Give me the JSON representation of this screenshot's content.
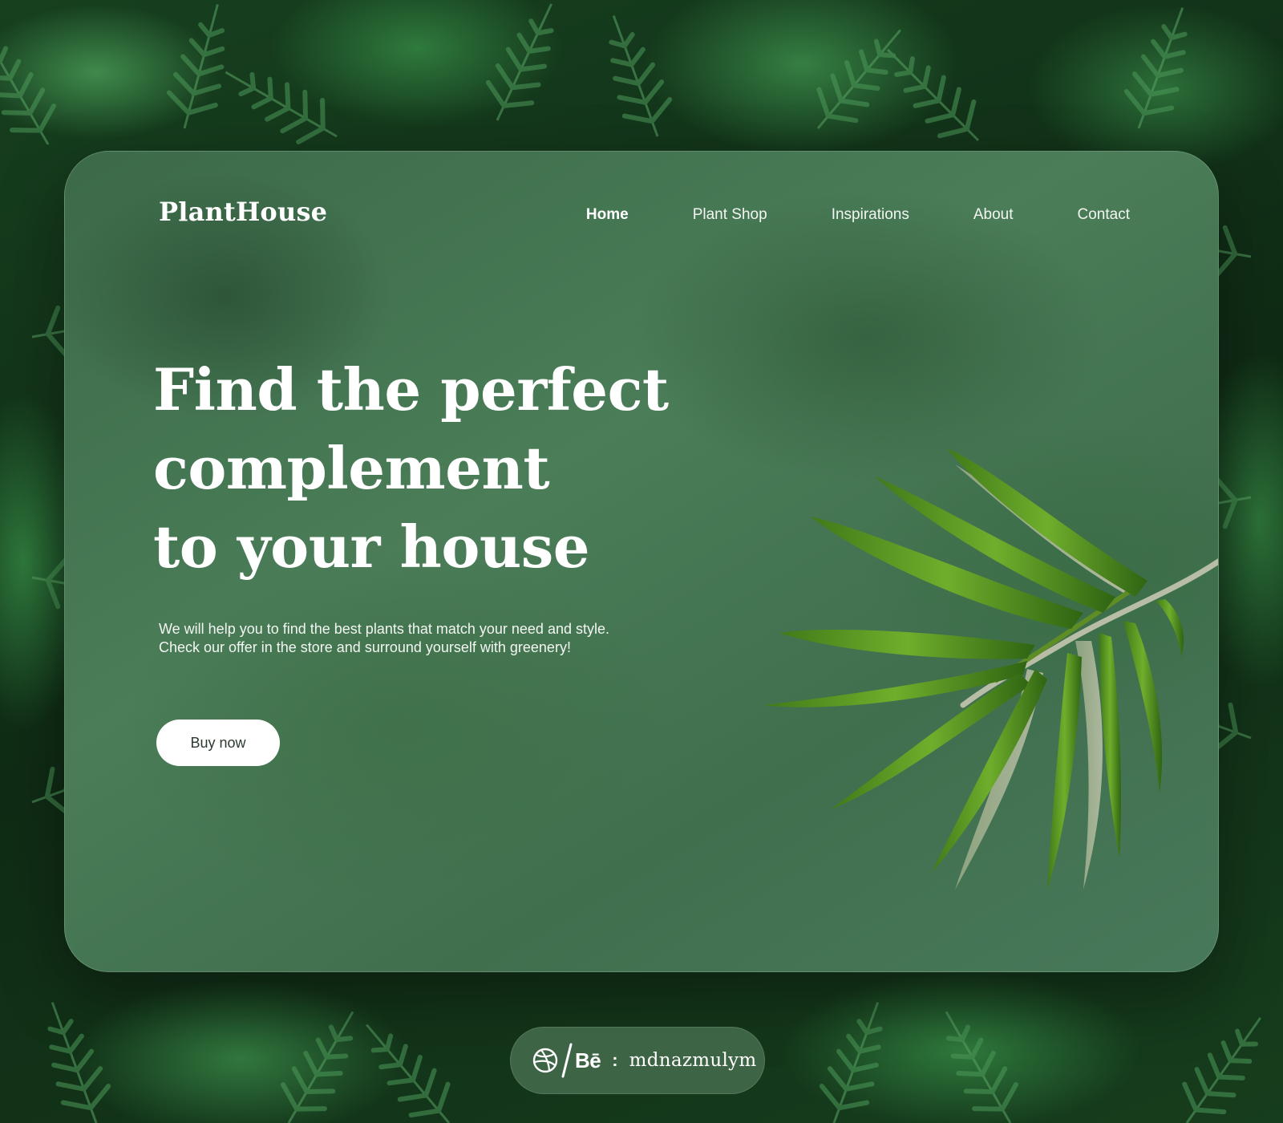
{
  "brand": {
    "logo": "PlantHouse"
  },
  "nav": {
    "items": [
      {
        "label": "Home",
        "active": true
      },
      {
        "label": "Plant Shop"
      },
      {
        "label": "Inspirations"
      },
      {
        "label": "About"
      },
      {
        "label": "Contact"
      }
    ]
  },
  "hero": {
    "headline_lines": [
      "Find the perfect",
      "complement",
      "to your house"
    ],
    "subtext_lines": [
      "We will help you to find the best plants that match your need and style.",
      "Check our offer in the store and surround yourself with greenery!"
    ],
    "cta_label": "Buy now"
  },
  "credit": {
    "behance_mark": "Bē",
    "separator": ":",
    "handle": "mdnazmulym"
  },
  "icons": {
    "dribbble": "dribbble-icon",
    "behance": "behance-icon",
    "leaf": "palm-leaf-illustration"
  },
  "colors": {
    "card": "#4a7d58",
    "background": "#17401f",
    "button_bg": "#ffffff",
    "button_text": "#2c3a30",
    "text": "#ffffff"
  }
}
